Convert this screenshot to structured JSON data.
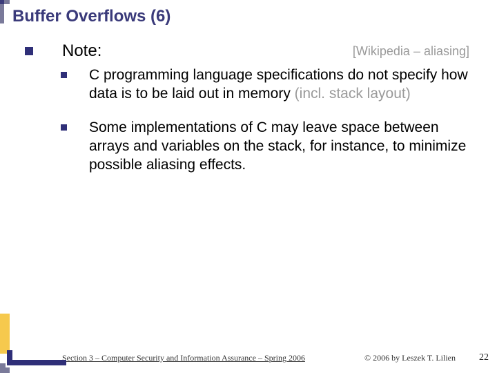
{
  "title": "Buffer Overflows (6)",
  "note": {
    "label": "Note:",
    "source": "[Wikipedia – aliasing]"
  },
  "items": [
    {
      "text_main": "C programming language specifications do not specify how data is to be laid out in memory ",
      "text_muted": "(incl. stack layout)"
    },
    {
      "text_main": "Some implementations of C may leave space between arrays and variables on the stack, for instance, to minimize possible aliasing effects.",
      "text_muted": ""
    }
  ],
  "footer": {
    "left": "Section 3 – Computer Security and Information Assurance – Spring 2006",
    "right": "© 2006 by Leszek T. Lilien",
    "page": "22"
  }
}
